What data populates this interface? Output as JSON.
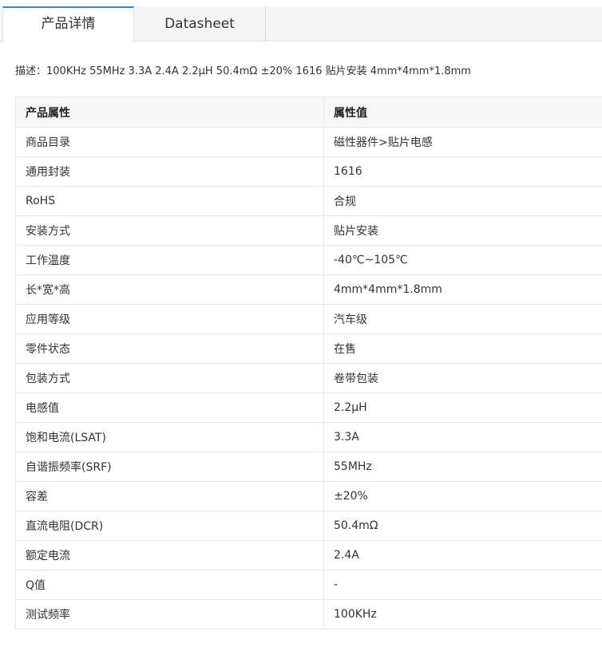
{
  "tabs": [
    {
      "label": "产品详情",
      "active": true
    },
    {
      "label": "Datasheet",
      "active": false
    }
  ],
  "description": "描述：100KHz 55MHz 3.3A 2.4A 2.2μH 50.4mΩ ±20% 1616 贴片安装 4mm*4mm*1.8mm",
  "table": {
    "headers": [
      "产品属性",
      "属性值"
    ],
    "rows": [
      [
        "商品目录",
        "磁性器件>贴片电感"
      ],
      [
        "通用封装",
        "1616"
      ],
      [
        "RoHS",
        "合规"
      ],
      [
        "安装方式",
        "贴片安装"
      ],
      [
        "工作温度",
        "-40℃~105℃"
      ],
      [
        "长*宽*高",
        "4mm*4mm*1.8mm"
      ],
      [
        "应用等级",
        "汽车级"
      ],
      [
        "零件状态",
        "在售"
      ],
      [
        "包装方式",
        "卷带包装"
      ],
      [
        "电感值",
        "2.2μH"
      ],
      [
        "饱和电流(LSAT)",
        "3.3A"
      ],
      [
        "自谐振频率(SRF)",
        "55MHz"
      ],
      [
        "容差",
        "±20%"
      ],
      [
        "直流电阻(DCR)",
        "50.4mΩ"
      ],
      [
        "额定电流",
        "2.4A"
      ],
      [
        "Q值",
        "-"
      ],
      [
        "测试频率",
        "100KHz"
      ]
    ]
  },
  "colors": {
    "accent": "#2a8dd4",
    "header_bg": "#f7f7f7",
    "border": "#e8e8e8"
  }
}
